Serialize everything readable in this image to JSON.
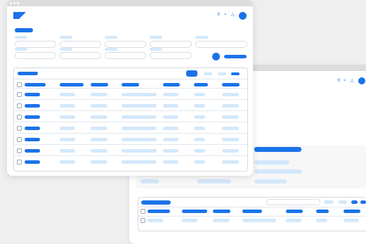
{
  "colors": {
    "accent": "#1a73e8",
    "light": "#d3e8fb",
    "window_bg": "#ffffff",
    "desktop_bg": "#efefef"
  },
  "front_window": {
    "header_icons": [
      "search-icon",
      "wifi-icon",
      "bell-icon",
      "avatar"
    ],
    "filter_fields_count": 8,
    "table_rows": 7,
    "table_columns": 8
  },
  "back_window": {
    "header_icons": [
      "search-icon",
      "wifi-icon",
      "bell-icon",
      "avatar"
    ],
    "table_rows": 1,
    "table_columns": 7
  }
}
